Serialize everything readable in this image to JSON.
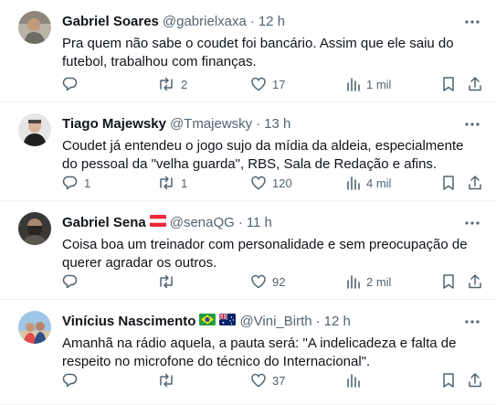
{
  "tweets": [
    {
      "name": "Gabriel Soares",
      "handle": "@gabrielxaxa",
      "separator": "·",
      "time": "12 h",
      "text": "Pra quem não sabe o coudet foi bancário. Assim que ele saiu do futebol, trabalhou com finanças.",
      "replies": "",
      "retweets": "2",
      "likes": "17",
      "views": "1 mil",
      "flags": []
    },
    {
      "name": "Tiago Majewsky",
      "handle": "@Tmajewsky",
      "separator": "·",
      "time": "13 h",
      "text": "Coudet já entendeu o jogo sujo da mídia da aldeia, especialmente do pessoal da \"velha guarda\", RBS, Sala de Redação e afins.",
      "replies": "1",
      "retweets": "1",
      "likes": "120",
      "views": "4 mil",
      "flags": []
    },
    {
      "name": "Gabriel Sena",
      "handle": "@senaQG",
      "separator": "·",
      "time": "11 h",
      "text": "Coisa boa um treinador com personalidade e sem preocupação de querer agradar os outros.",
      "replies": "",
      "retweets": "",
      "likes": "92",
      "views": "2 mil",
      "flags": [
        "austria-flag-icon"
      ]
    },
    {
      "name": "Vinícius Nascimento",
      "handle": "@Vini_Birth",
      "separator": "·",
      "time": "12 h",
      "text": "Amanhã na rádio aquela, a pauta será: \"A indelicadeza e falta de respeito no microfone do técnico do Internacional\".",
      "replies": "",
      "retweets": "",
      "likes": "37",
      "views": "",
      "flags": [
        "brazil-flag-icon",
        "australia-flag-icon"
      ]
    }
  ],
  "colors": {
    "text_primary": "#0f1419",
    "text_secondary": "#536471",
    "divider": "#eff3f4"
  }
}
